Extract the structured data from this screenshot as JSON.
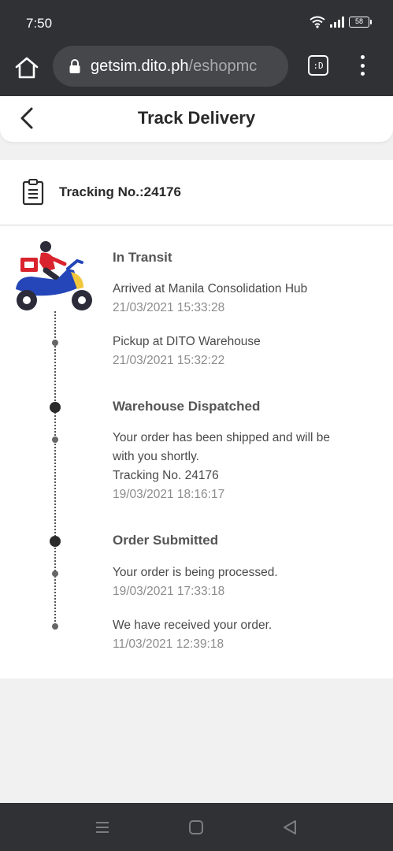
{
  "status_bar": {
    "time": "7:50",
    "battery": "58"
  },
  "browser": {
    "url_domain": "getsim.dito.ph",
    "url_path": "/eshopmc",
    "tab_label": ":D"
  },
  "header": {
    "title": "Track Delivery"
  },
  "tracking": {
    "label": "Tracking No.:24176"
  },
  "timeline": {
    "in_transit": {
      "title": "In Transit",
      "events": [
        {
          "text": "Arrived at Manila Consolidation Hub",
          "date": "21/03/2021 15:33:28"
        },
        {
          "text": "Pickup at DITO Warehouse",
          "date": "21/03/2021 15:32:22"
        }
      ]
    },
    "dispatched": {
      "title": "Warehouse Dispatched",
      "line1": "Your order has been shipped and will be",
      "line2": "with you shortly.",
      "line3": "Tracking No. 24176",
      "date": "19/03/2021 18:16:17"
    },
    "submitted": {
      "title": "Order Submitted",
      "events": [
        {
          "text": "Your order is being processed.",
          "date": "19/03/2021 17:33:18"
        },
        {
          "text": "We have received your order.",
          "date": "11/03/2021 12:39:18"
        }
      ]
    }
  },
  "colors": {
    "accent_red": "#d9232d",
    "scooter_blue": "#2446b8",
    "scooter_yellow": "#f3c73b"
  }
}
